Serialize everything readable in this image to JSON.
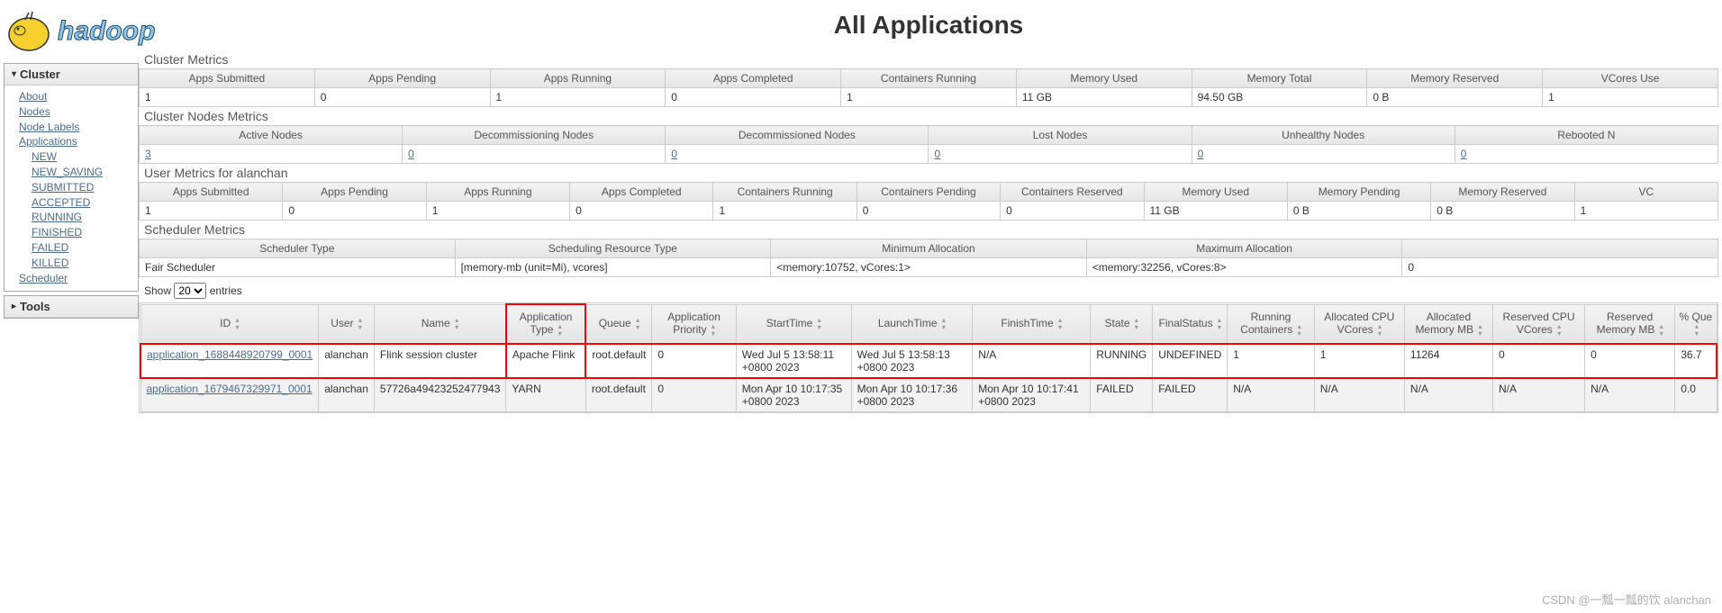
{
  "page_title": "All Applications",
  "sidebar": {
    "cluster_label": "Cluster",
    "tools_label": "Tools",
    "links": {
      "about": "About",
      "nodes": "Nodes",
      "node_labels": "Node Labels",
      "applications": "Applications",
      "scheduler": "Scheduler"
    },
    "app_states": [
      "NEW",
      "NEW_SAVING",
      "SUBMITTED",
      "ACCEPTED",
      "RUNNING",
      "FINISHED",
      "FAILED",
      "KILLED"
    ]
  },
  "cluster_metrics": {
    "title": "Cluster Metrics",
    "headers": [
      "Apps Submitted",
      "Apps Pending",
      "Apps Running",
      "Apps Completed",
      "Containers Running",
      "Memory Used",
      "Memory Total",
      "Memory Reserved",
      "VCores Use"
    ],
    "values": [
      "1",
      "0",
      "1",
      "0",
      "1",
      "11 GB",
      "94.50 GB",
      "0 B",
      "1"
    ]
  },
  "cluster_nodes": {
    "title": "Cluster Nodes Metrics",
    "headers": [
      "Active Nodes",
      "Decommissioning Nodes",
      "Decommissioned Nodes",
      "Lost Nodes",
      "Unhealthy Nodes",
      "Rebooted N"
    ],
    "values": [
      "3",
      "0",
      "0",
      "0",
      "0",
      "0"
    ]
  },
  "user_metrics": {
    "title": "User Metrics for alanchan",
    "headers": [
      "Apps Submitted",
      "Apps Pending",
      "Apps Running",
      "Apps Completed",
      "Containers Running",
      "Containers Pending",
      "Containers Reserved",
      "Memory Used",
      "Memory Pending",
      "Memory Reserved",
      "VC"
    ],
    "values": [
      "1",
      "0",
      "1",
      "0",
      "1",
      "0",
      "0",
      "11 GB",
      "0 B",
      "0 B",
      "1"
    ]
  },
  "scheduler_metrics": {
    "title": "Scheduler Metrics",
    "headers": [
      "Scheduler Type",
      "Scheduling Resource Type",
      "Minimum Allocation",
      "Maximum Allocation",
      ""
    ],
    "values": [
      "Fair Scheduler",
      "[memory-mb (unit=Mi), vcores]",
      "<memory:10752, vCores:1>",
      "<memory:32256, vCores:8>",
      "0"
    ]
  },
  "show_entries": {
    "prefix": "Show",
    "suffix": "entries",
    "value": "20"
  },
  "apps_headers": [
    "ID",
    "User",
    "Name",
    "Application Type",
    "Queue",
    "Application Priority",
    "StartTime",
    "LaunchTime",
    "FinishTime",
    "State",
    "FinalStatus",
    "Running Containers",
    "Allocated CPU VCores",
    "Allocated Memory MB",
    "Reserved CPU VCores",
    "Reserved Memory MB",
    "% Que"
  ],
  "apps": [
    {
      "id": "application_1688448920799_0001",
      "user": "alanchan",
      "name": "Flink session cluster",
      "type": "Apache Flink",
      "queue": "root.default",
      "priority": "0",
      "start": "Wed Jul 5 13:58:11 +0800 2023",
      "launch": "Wed Jul 5 13:58:13 +0800 2023",
      "finish": "N/A",
      "state": "RUNNING",
      "final": "UNDEFINED",
      "running_containers": "1",
      "alloc_vcores": "1",
      "alloc_mem": "11264",
      "res_vcores": "0",
      "res_mem": "0",
      "pct": "36.7"
    },
    {
      "id": "application_1679467329971_0001",
      "user": "alanchan",
      "name": "57726a49423252477943",
      "type": "YARN",
      "queue": "root.default",
      "priority": "0",
      "start": "Mon Apr 10 10:17:35 +0800 2023",
      "launch": "Mon Apr 10 10:17:36 +0800 2023",
      "finish": "Mon Apr 10 10:17:41 +0800 2023",
      "state": "FAILED",
      "final": "FAILED",
      "running_containers": "N/A",
      "alloc_vcores": "N/A",
      "alloc_mem": "N/A",
      "res_vcores": "N/A",
      "res_mem": "N/A",
      "pct": "0.0"
    }
  ],
  "watermark": "CSDN @一瓢一瓢的饮 alanchan"
}
